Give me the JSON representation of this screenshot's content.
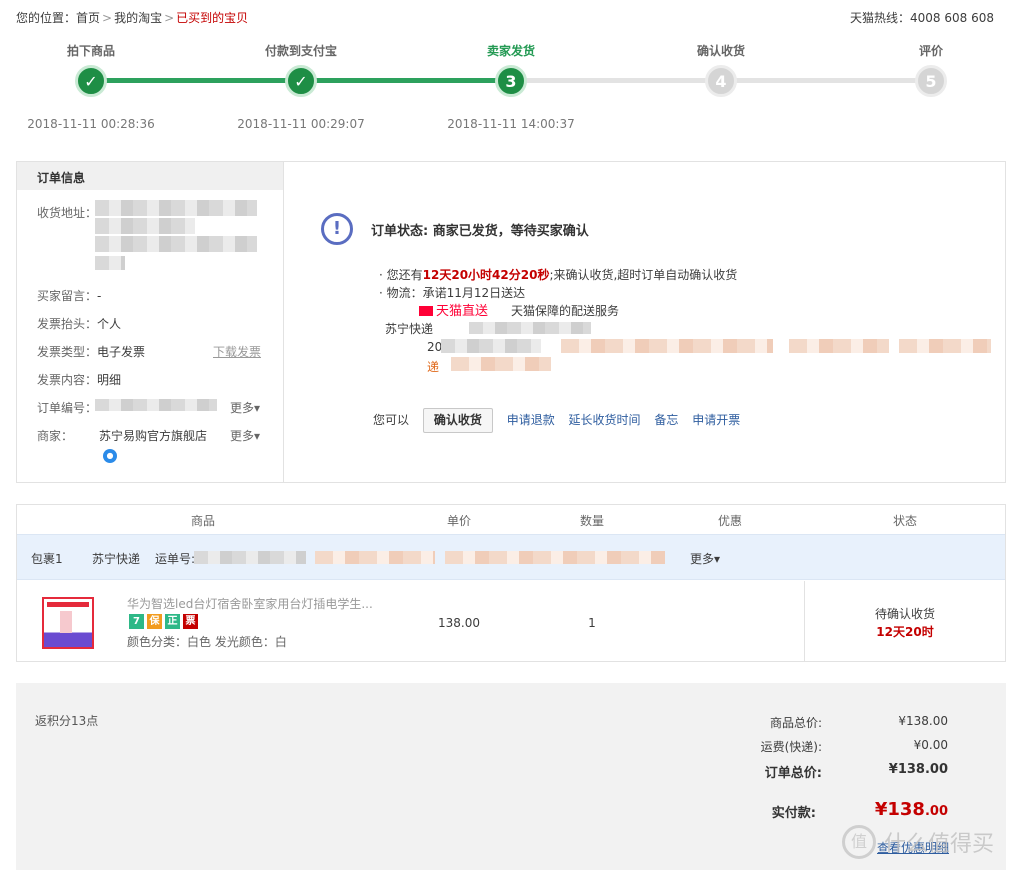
{
  "breadcrumb": {
    "prefix": "您的位置：",
    "items": [
      "首页",
      "我的淘宝",
      "已买到的宝贝"
    ],
    "sep": ">"
  },
  "hotline": "天猫热线：4008 608 608",
  "steps": [
    {
      "label": "拍下商品",
      "mark": "✓",
      "time": "2018-11-11 00:28:36",
      "state": "done"
    },
    {
      "label": "付款到支付宝",
      "mark": "✓",
      "time": "2018-11-11 00:29:07",
      "state": "done"
    },
    {
      "label": "卖家发货",
      "mark": "3",
      "time": "2018-11-11 14:00:37",
      "state": "current"
    },
    {
      "label": "确认收货",
      "mark": "4",
      "time": "",
      "state": "todo"
    },
    {
      "label": "评价",
      "mark": "5",
      "time": "",
      "state": "todo"
    }
  ],
  "order_info": {
    "heading": "订单信息",
    "address_label": "收货地址：",
    "message_label": "买家留言：",
    "message_value": "-",
    "invoice_title_label": "发票抬头：",
    "invoice_title_value": "个人",
    "invoice_type_label": "发票类型：",
    "invoice_type_value": "电子发票",
    "download_invoice": "下载发票",
    "invoice_content_label": "发票内容：",
    "invoice_content_value": "明细",
    "order_no_label": "订单编号：",
    "more_label": "更多",
    "seller_label": "商家：",
    "seller_value": "苏宁易购官方旗舰店",
    "seller_more": "更多"
  },
  "status": {
    "title": "订单状态: 商家已发货，等待买家确认",
    "remain_prefix": "· 您还有",
    "remain_time": "12天20小时42分20秒",
    "remain_suffix": ";来确认收货,超时订单自动确认收货",
    "logistics": "· 物流：承诺11月12日送达",
    "tmall_logo": "天猫直送",
    "tmall_desc": "天猫保障的配送服务",
    "express": "苏宁快递",
    "trk_prefix": "20",
    "trk_send": "递",
    "you_can": "您可以",
    "confirm_btn": "确认收货",
    "links": [
      "申请退款",
      "延长收货时间",
      "备忘",
      "申请开票"
    ]
  },
  "table": {
    "headers": [
      "商品",
      "单价",
      "数量",
      "优惠",
      "状态"
    ],
    "package": {
      "name": "包裹1",
      "carrier": "苏宁快递",
      "tracking_label": "运单号:",
      "more": "更多"
    },
    "item": {
      "title": "华为智选led台灯宿舍卧室家用台灯插电学生...",
      "badges": [
        "7",
        "保",
        "正",
        "票"
      ],
      "badge_colors": [
        "#2eb887",
        "#f29c1f",
        "#2eb887",
        "#c40000"
      ],
      "sku": "颜色分类：白色 发光颜色：白",
      "price": "138.00",
      "qty": "1",
      "state": "待确认收货",
      "state_time": "12天20时"
    }
  },
  "totals": {
    "points": "返积分13点",
    "goods_label": "商品总价:",
    "goods_value": "¥138.00",
    "shipping_label": "运费(快递):",
    "shipping_value": "¥0.00",
    "order_total_label": "订单总价:",
    "order_total_value": "¥138.00",
    "paid_label": "实付款:",
    "paid_int": "¥138",
    "paid_dec": ".00",
    "view_link": "查看优惠明细"
  },
  "watermark": "值 什么值得买"
}
